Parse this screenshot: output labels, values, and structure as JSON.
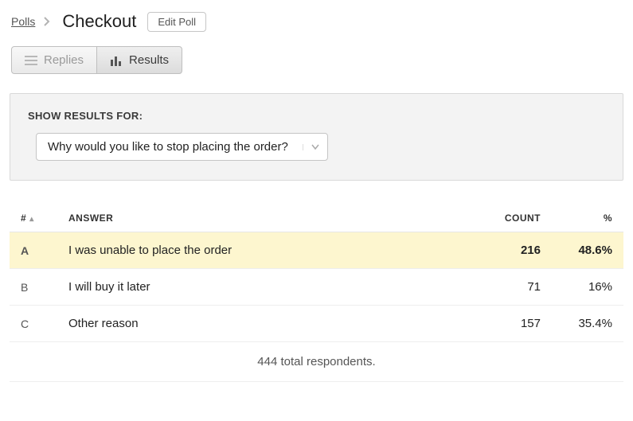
{
  "breadcrumb": {
    "root": "Polls",
    "current": "Checkout"
  },
  "actions": {
    "edit": "Edit Poll"
  },
  "tabs": {
    "replies": "Replies",
    "results": "Results"
  },
  "filter": {
    "heading": "SHOW RESULTS FOR:",
    "selected": "Why would you like to stop placing the order?"
  },
  "table": {
    "headers": {
      "idx": "#",
      "answer": "ANSWER",
      "count": "COUNT",
      "pct": "%"
    },
    "rows": [
      {
        "idx": "A",
        "answer": "I was unable to place the order",
        "count": "216",
        "pct": "48.6%",
        "hl": true
      },
      {
        "idx": "B",
        "answer": "I will buy it later",
        "count": "71",
        "pct": "16%",
        "hl": false
      },
      {
        "idx": "C",
        "answer": "Other reason",
        "count": "157",
        "pct": "35.4%",
        "hl": false
      }
    ],
    "totals": "444 total respondents."
  }
}
